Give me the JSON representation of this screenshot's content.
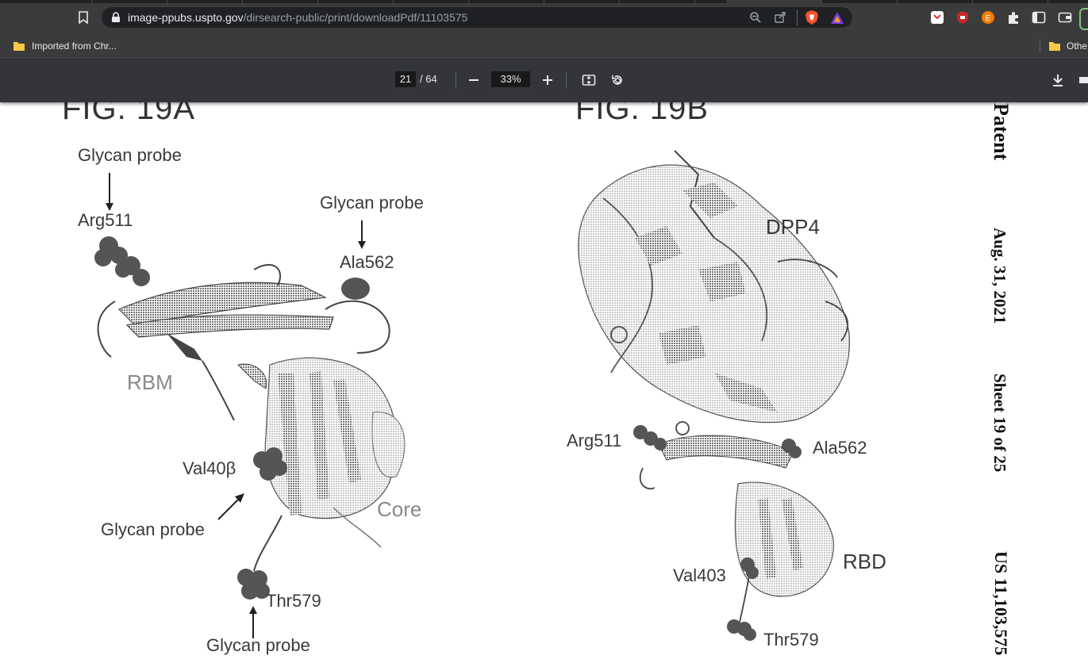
{
  "browser": {
    "url_host": "image-ppubs.uspto.gov",
    "url_path": "/dirsearch-public/print/downloadPdf/11103575",
    "bookmark_left": "Imported from Chr...",
    "bookmark_right": "Othe"
  },
  "pdf_toolbar": {
    "page_current": "21",
    "page_total": "/ 64",
    "zoom": "33%"
  },
  "document": {
    "fig_a": {
      "title": "FIG. 19A",
      "labels": {
        "glycan_probe_1": "Glycan probe",
        "arg511": "Arg511",
        "glycan_probe_2": "Glycan probe",
        "ala562": "Ala562",
        "rbm": "RBM",
        "val40": "Val40β",
        "glycan_probe_3": "Glycan probe",
        "core": "Core",
        "thr579": "Thr579",
        "glycan_probe_4": "Glycan probe"
      }
    },
    "fig_b": {
      "title": "FIG. 19B",
      "labels": {
        "dpp4": "DPP4",
        "arg511": "Arg511",
        "ala562": "Ala562",
        "val403": "Val403",
        "rbd": "RBD",
        "thr579": "Thr579"
      }
    },
    "margin": {
      "patent": "Patent",
      "date": "Aug. 31, 2021",
      "sheet": "Sheet 19 of 25",
      "number": "US 11,103,575"
    }
  },
  "colors": {
    "browser_chrome": "#3b3b3b",
    "pdf_toolbar": "#333538",
    "page_bg": "#ffffff"
  }
}
